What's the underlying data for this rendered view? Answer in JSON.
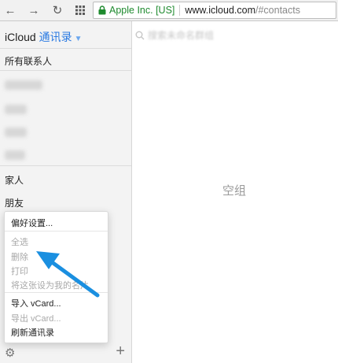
{
  "browser": {
    "security_label": "Apple Inc. [US]",
    "url_host": "www.icloud.com",
    "url_path": "/#contacts"
  },
  "header": {
    "app": "iCloud",
    "group": "通讯录"
  },
  "sidebar": {
    "all_contacts": "所有联系人",
    "groups": [
      "家人",
      "朋友"
    ]
  },
  "search": {
    "placeholder": "搜索未命名群组"
  },
  "main": {
    "empty_text": "空组"
  },
  "menu": {
    "preferences": "偏好设置...",
    "select_all": "全选",
    "delete": "删除",
    "print": "打印",
    "set_as_my_card": "将这张设为我的名片",
    "import_vcard": "导入 vCard...",
    "export_vcard": "导出 vCard...",
    "refresh": "刷新通讯录"
  },
  "colors": {
    "accent": "#2a7ae2",
    "secure": "#1e8a2e",
    "arrow": "#1a8fe0"
  }
}
